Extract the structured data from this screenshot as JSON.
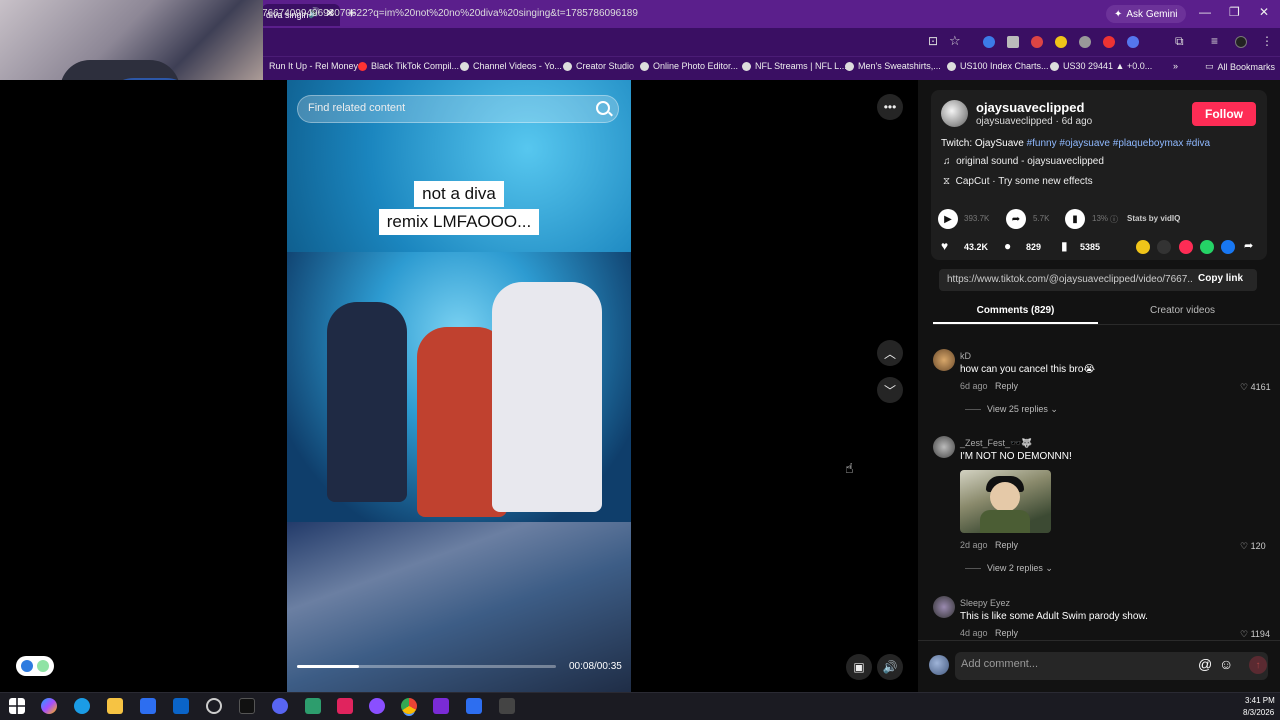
{
  "browser": {
    "tab_title": "diva singin",
    "url": "766740994969307062​2?q=im%20not%20no%20diva%20singing&t=1785786096189",
    "ask_gemini": "Ask Gemini",
    "bookmarks": [
      "Run It Up - Rel Money",
      "Black TikTok Compil...",
      "Channel Videos - Yo...",
      "Creator Studio",
      "Online Photo Editor...",
      "NFL Streams | NFL L...",
      "Men's Sweatshirts,...",
      "US100 Index Charts...",
      "US30 29441 ▲ +0.0..."
    ],
    "all_bookmarks": "All Bookmarks"
  },
  "video": {
    "search_placeholder": "Find related content",
    "caption_line1": "not a diva",
    "caption_line2": "remix LMFAOOO...",
    "time": "00:08/00:35",
    "progress": 0.24
  },
  "author": {
    "username": "ojaysuaveclipped",
    "handle": "ojaysuaveclipped",
    "posted": "6d ago",
    "follow_label": "Follow",
    "desc_prefix": "Twitch: OjaySuave ",
    "hashtags": "#funny #ojaysuave #plaqueboymax #diva",
    "sound": "original sound - ojaysuaveclipped",
    "capcut": "CapCut · Try some new effects"
  },
  "stats": {
    "plays": "393.7K",
    "shares": "5.7K",
    "percent": "13%",
    "vidiq": "Stats by vidIQ",
    "likes": "43.2K",
    "comments": "829",
    "saves": "5385"
  },
  "link": {
    "url": "https://www.tiktok.com/@ojaysuaveclipped/video/7667...",
    "copy_label": "Copy link"
  },
  "tabs": {
    "comments": "Comments (829)",
    "creator": "Creator videos"
  },
  "comments": [
    {
      "name": "kD",
      "text": "how can you cancel this bro😭",
      "age": "6d ago",
      "reply": "Reply",
      "likes": "4161",
      "replies": "View 25 replies"
    },
    {
      "name": "_Zest_Fest_🕶️🐺",
      "text": "I'M NOT NO DEMONNN!",
      "age": "2d ago",
      "reply": "Reply",
      "likes": "120",
      "replies": "View 2 replies"
    },
    {
      "name": "Sleepy Eyez",
      "text": "This is like some Adult Swim parody show.",
      "age": "4d ago",
      "reply": "Reply",
      "likes": "1194"
    }
  ],
  "comment_box": {
    "placeholder": "Add comment..."
  },
  "clock": {
    "time": "3:41 PM",
    "date": "8/3/2026"
  }
}
